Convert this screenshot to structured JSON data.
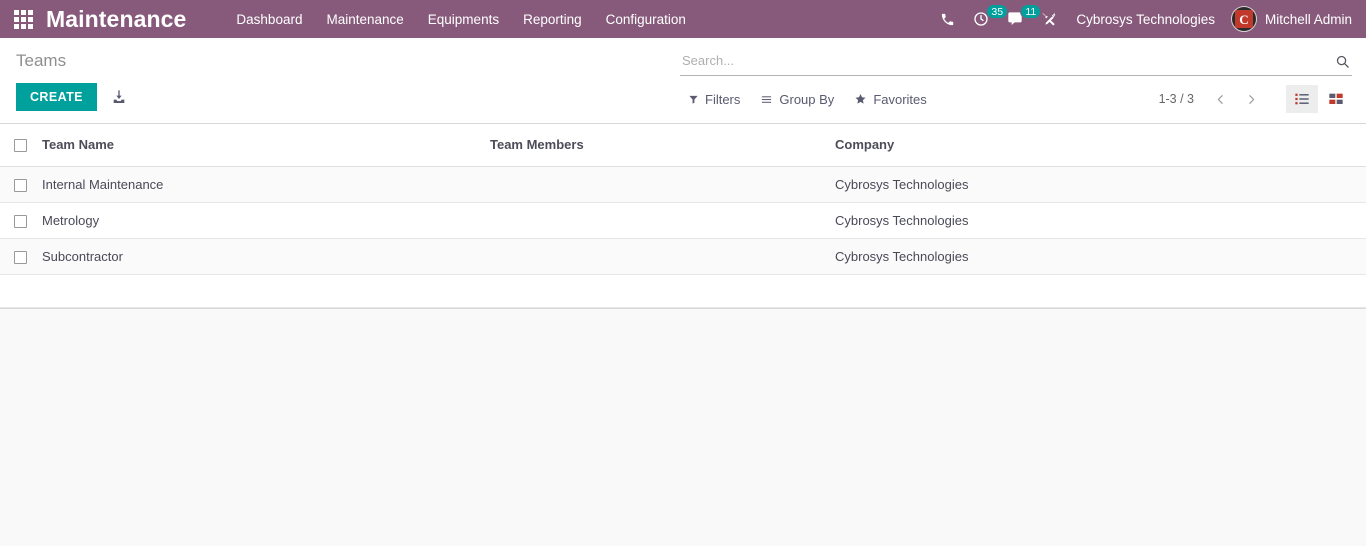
{
  "navbar": {
    "apps_icon": "apps-grid-icon",
    "brand": "Maintenance",
    "menu": [
      {
        "label": "Dashboard"
      },
      {
        "label": "Maintenance"
      },
      {
        "label": "Equipments"
      },
      {
        "label": "Reporting"
      },
      {
        "label": "Configuration"
      }
    ],
    "icons": {
      "phone": "phone-icon",
      "activity": "clock-activity-icon",
      "messages": "chat-bubble-icon",
      "debug": "wrench-screwdriver-icon"
    },
    "activity_count": "35",
    "message_count": "11",
    "company": "Cybrosys Technologies",
    "user": "Mitchell Admin",
    "avatar_letter": "C",
    "colors": {
      "navbar_bg": "#875A7B",
      "badge_bg": "#00A09D",
      "primary_btn": "#00A09D"
    }
  },
  "control_panel": {
    "breadcrumb": "Teams",
    "create_label": "CREATE",
    "import_icon": "import-download-icon",
    "search": {
      "placeholder": "Search...",
      "value": "",
      "icon": "search-magnifier-icon"
    },
    "dropdowns": [
      {
        "label": "Filters",
        "icon": "filter-funnel-icon"
      },
      {
        "label": "Group By",
        "icon": "group-by-lines-icon"
      },
      {
        "label": "Favorites",
        "icon": "star-icon"
      }
    ],
    "pager": {
      "range": "1-3 / 3",
      "prev_icon": "chevron-left-icon",
      "next_icon": "chevron-right-icon"
    },
    "views": [
      {
        "name": "list",
        "icon": "list-view-icon",
        "active": true
      },
      {
        "name": "kanban",
        "icon": "kanban-view-icon",
        "active": false
      }
    ]
  },
  "list": {
    "columns": [
      {
        "key": "team_name",
        "label": "Team Name"
      },
      {
        "key": "team_members",
        "label": "Team Members"
      },
      {
        "key": "company",
        "label": "Company"
      }
    ],
    "rows": [
      {
        "team_name": "Internal Maintenance",
        "team_members": "",
        "company": "Cybrosys Technologies"
      },
      {
        "team_name": "Metrology",
        "team_members": "",
        "company": "Cybrosys Technologies"
      },
      {
        "team_name": "Subcontractor",
        "team_members": "",
        "company": "Cybrosys Technologies"
      }
    ]
  }
}
